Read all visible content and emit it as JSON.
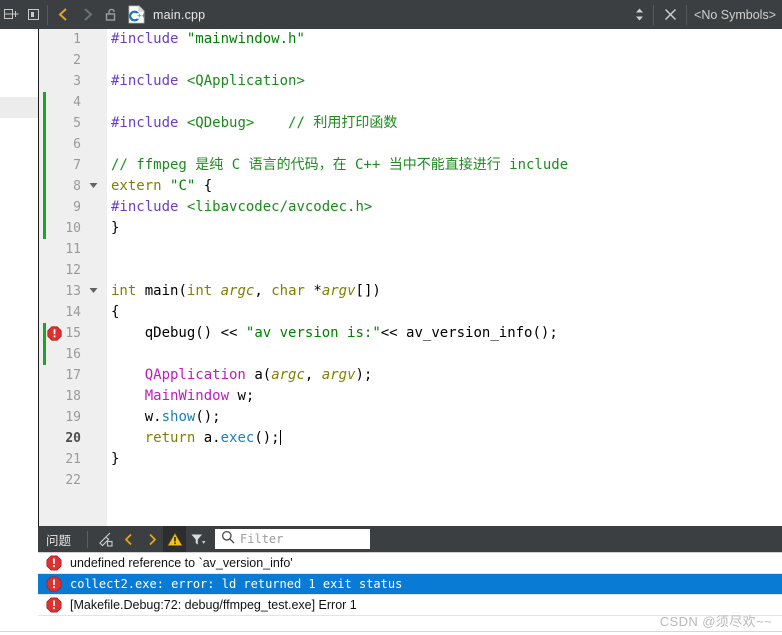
{
  "tabbar": {
    "split_h_icon": "split-horizontal-icon",
    "split_v_icon": "split-vertical-icon",
    "back_icon": "navigate-back-icon",
    "forward_icon": "navigate-forward-icon",
    "lock_icon": "unlocked-padlock-icon",
    "file_icon": "cpp-file-icon",
    "filename": "main.cpp",
    "updown_icon": "document-list-chevrons-icon",
    "close_icon": "close-document-icon",
    "symbols_label": "<No Symbols>"
  },
  "editor": {
    "current_line": 20,
    "error_line": 15,
    "lines": [
      {
        "n": 1,
        "fold": "",
        "error": false,
        "change": false
      },
      {
        "n": 2,
        "fold": "",
        "error": false,
        "change": false
      },
      {
        "n": 3,
        "fold": "",
        "error": false,
        "change": false
      },
      {
        "n": 4,
        "fold": "",
        "error": false,
        "change": true
      },
      {
        "n": 5,
        "fold": "",
        "error": false,
        "change": true
      },
      {
        "n": 6,
        "fold": "",
        "error": false,
        "change": true
      },
      {
        "n": 7,
        "fold": "",
        "error": false,
        "change": true
      },
      {
        "n": 8,
        "fold": "collapse",
        "error": false,
        "change": true
      },
      {
        "n": 9,
        "fold": "",
        "error": false,
        "change": true
      },
      {
        "n": 10,
        "fold": "",
        "error": false,
        "change": true
      },
      {
        "n": 11,
        "fold": "",
        "error": false,
        "change": false
      },
      {
        "n": 12,
        "fold": "",
        "error": false,
        "change": false
      },
      {
        "n": 13,
        "fold": "collapse",
        "error": false,
        "change": false
      },
      {
        "n": 14,
        "fold": "",
        "error": false,
        "change": false
      },
      {
        "n": 15,
        "fold": "",
        "error": true,
        "change": true
      },
      {
        "n": 16,
        "fold": "",
        "error": false,
        "change": true
      },
      {
        "n": 17,
        "fold": "",
        "error": false,
        "change": false
      },
      {
        "n": 18,
        "fold": "",
        "error": false,
        "change": false
      },
      {
        "n": 19,
        "fold": "",
        "error": false,
        "change": false
      },
      {
        "n": 20,
        "fold": "",
        "error": false,
        "change": false
      },
      {
        "n": 21,
        "fold": "",
        "error": false,
        "change": false
      },
      {
        "n": 22,
        "fold": "",
        "error": false,
        "change": false
      }
    ],
    "code_text": [
      "#include \"mainwindow.h\"",
      "",
      "#include <QApplication>",
      "",
      "#include <QDebug>    // 利用打印函数",
      "",
      "// ffmpeg 是纯 C 语言的代码，在 C++ 当中不能直接进行 include",
      "extern \"C\" {",
      "#include <libavcodec/avcodec.h>",
      "}",
      "",
      "",
      "int main(int argc, char *argv[])",
      "{",
      "    qDebug() << \"av version is:\"<< av_version_info();",
      "",
      "    QApplication a(argc, argv);",
      "    MainWindow w;",
      "    w.show();",
      "    return a.exec();",
      "}",
      ""
    ]
  },
  "panel": {
    "title": "问题",
    "clear_icon": "clear-broom-icon",
    "prev_icon": "previous-issue-icon",
    "next_icon": "next-issue-icon",
    "warning_icon": "warning-filter-icon",
    "filter_icon": "filter-funnel-icon",
    "search_icon": "search-icon",
    "filter_placeholder": "Filter",
    "issues": [
      {
        "icon": "error-icon",
        "text": "undefined reference to `av_version_info'",
        "selected": false
      },
      {
        "icon": "error-icon",
        "text": "collect2.exe: error: ld returned 1 exit status",
        "selected": true
      },
      {
        "icon": "error-icon",
        "text": "[Makefile.Debug:72: debug/ffmpeg_test.exe] Error 1",
        "selected": false
      }
    ]
  },
  "watermark": {
    "text": "CSDN @须尽欢~~"
  },
  "colors": {
    "chrome": "#3c3f41",
    "accent_orange": "#e8a317",
    "selection_blue": "#0a7bd5",
    "error_red": "#e03131",
    "change_green": "#22a22a",
    "gutter": "#efefef"
  }
}
